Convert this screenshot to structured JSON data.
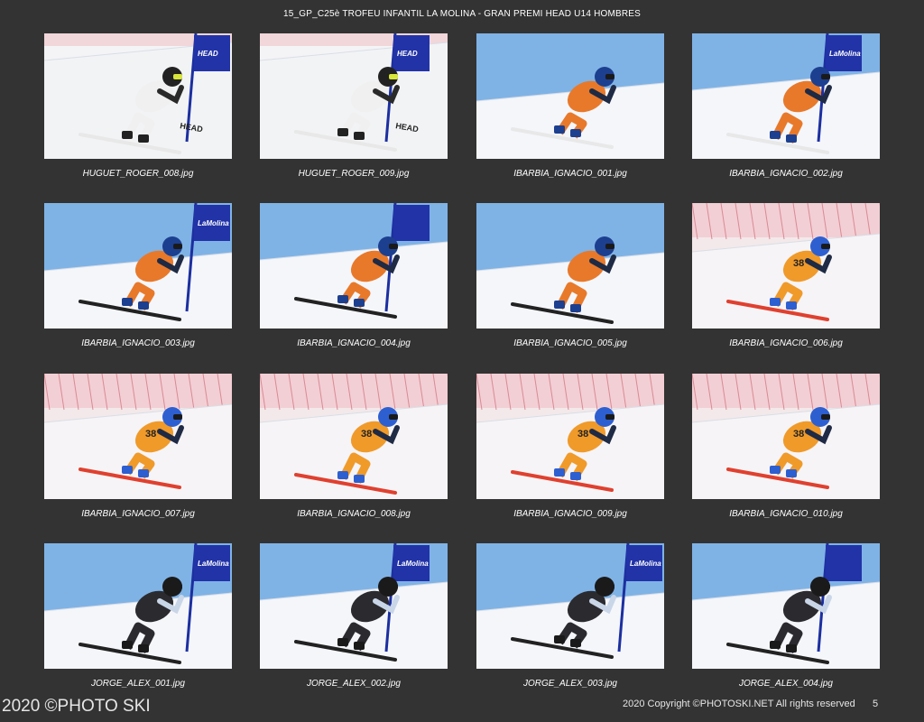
{
  "page": {
    "title": "15_GP_C25è TROFEU INFANTIL LA MOLINA - GRAN PREMI HEAD U14 HOMBRES",
    "footer_left": "2020 ©PHOTO SKI",
    "footer_right": "2020 Copyright ©PHOTOSKI.NET All rights reserved",
    "page_number": "5"
  },
  "photos": [
    {
      "filename": "HUGUET_ROGER_008.jpg",
      "scene": "white-bib-skier",
      "bib": "",
      "banner_text": "HEAD",
      "colors": {
        "sky": "#f4f4f6",
        "snow": "#f2f3f5",
        "suit": "#f0f0f0",
        "accent": "#2a2a2a",
        "helmet": "#222222",
        "visor": "#d8e63a",
        "skis": "#e8e8e8"
      }
    },
    {
      "filename": "HUGUET_ROGER_009.jpg",
      "scene": "white-bib-skier",
      "bib": "",
      "banner_text": "HEAD",
      "colors": {
        "sky": "#f4f4f6",
        "snow": "#f2f3f5",
        "suit": "#f0f0f0",
        "accent": "#2a2a2a",
        "helmet": "#222222",
        "visor": "#d8e63a",
        "skis": "#e8e8e8"
      }
    },
    {
      "filename": "IBARBIA_IGNACIO_001.jpg",
      "scene": "orange-skier-sky",
      "bib": "",
      "banner_text": "",
      "colors": {
        "sky": "#7fb3e6",
        "snow": "#f4f6fa",
        "suit": "#e8792a",
        "accent": "#1f2a44",
        "helmet": "#1d3f8f",
        "visor": "#1a1a1a",
        "skis": "#e8e8e8"
      }
    },
    {
      "filename": "IBARBIA_IGNACIO_002.jpg",
      "scene": "orange-skier-sky",
      "bib": "",
      "banner_text": "LaMolina",
      "colors": {
        "sky": "#7fb3e6",
        "snow": "#f4f6fa",
        "suit": "#e8792a",
        "accent": "#1f2a44",
        "helmet": "#1d3f8f",
        "visor": "#1a1a1a",
        "skis": "#e8e8e8"
      }
    },
    {
      "filename": "IBARBIA_IGNACIO_003.jpg",
      "scene": "orange-skier-gate",
      "bib": "",
      "banner_text": "LaMolina",
      "colors": {
        "sky": "#7fb3e6",
        "snow": "#f4f6fa",
        "suit": "#e8792a",
        "accent": "#1f2a44",
        "helmet": "#1d3f8f",
        "visor": "#1a1a1a",
        "skis": "#222222"
      }
    },
    {
      "filename": "IBARBIA_IGNACIO_004.jpg",
      "scene": "orange-skier-gate",
      "bib": "",
      "banner_text": "",
      "colors": {
        "sky": "#7fb3e6",
        "snow": "#f4f6fa",
        "suit": "#e8792a",
        "accent": "#1f2a44",
        "helmet": "#1d3f8f",
        "visor": "#1a1a1a",
        "skis": "#222222"
      }
    },
    {
      "filename": "IBARBIA_IGNACIO_005.jpg",
      "scene": "orange-skier-sky",
      "bib": "",
      "banner_text": "",
      "colors": {
        "sky": "#7fb3e6",
        "snow": "#f4f6fa",
        "suit": "#e8792a",
        "accent": "#1f2a44",
        "helmet": "#1d3f8f",
        "visor": "#1a1a1a",
        "skis": "#222222"
      }
    },
    {
      "filename": "IBARBIA_IGNACIO_006.jpg",
      "scene": "orange-skier-fence",
      "bib": "38",
      "banner_text": "",
      "colors": {
        "sky": "#f3e9ea",
        "snow": "#f6f4f6",
        "suit": "#f09a2a",
        "accent": "#1f2a44",
        "helmet": "#2e5fd1",
        "visor": "#1a1a1a",
        "skis": "#e0402f"
      }
    },
    {
      "filename": "IBARBIA_IGNACIO_007.jpg",
      "scene": "orange-skier-fence",
      "bib": "38",
      "banner_text": "",
      "colors": {
        "sky": "#f3e9ea",
        "snow": "#f6f4f6",
        "suit": "#f09a2a",
        "accent": "#1f2a44",
        "helmet": "#2e5fd1",
        "visor": "#1a1a1a",
        "skis": "#e0402f"
      }
    },
    {
      "filename": "IBARBIA_IGNACIO_008.jpg",
      "scene": "orange-skier-fence",
      "bib": "38",
      "banner_text": "",
      "colors": {
        "sky": "#f3e9ea",
        "snow": "#f6f4f6",
        "suit": "#f09a2a",
        "accent": "#1f2a44",
        "helmet": "#2e5fd1",
        "visor": "#1a1a1a",
        "skis": "#e0402f"
      }
    },
    {
      "filename": "IBARBIA_IGNACIO_009.jpg",
      "scene": "orange-skier-fence",
      "bib": "38",
      "banner_text": "",
      "colors": {
        "sky": "#f3e9ea",
        "snow": "#f6f4f6",
        "suit": "#f09a2a",
        "accent": "#1f2a44",
        "helmet": "#2e5fd1",
        "visor": "#1a1a1a",
        "skis": "#e0402f"
      }
    },
    {
      "filename": "IBARBIA_IGNACIO_010.jpg",
      "scene": "orange-skier-fence",
      "bib": "38",
      "banner_text": "",
      "colors": {
        "sky": "#f3e9ea",
        "snow": "#f6f4f6",
        "suit": "#f09a2a",
        "accent": "#1f2a44",
        "helmet": "#2e5fd1",
        "visor": "#1a1a1a",
        "skis": "#e0402f"
      }
    },
    {
      "filename": "JORGE_ALEX_001.jpg",
      "scene": "dark-skier-gate",
      "bib": "",
      "banner_text": "LaMolina",
      "colors": {
        "sky": "#7fb3e6",
        "snow": "#f4f6fa",
        "suit": "#2b2b2f",
        "accent": "#c8d6e8",
        "helmet": "#1a1a1a",
        "visor": "#1a1a1a",
        "skis": "#222222"
      }
    },
    {
      "filename": "JORGE_ALEX_002.jpg",
      "scene": "dark-skier-gate",
      "bib": "",
      "banner_text": "LaMolina",
      "colors": {
        "sky": "#7fb3e6",
        "snow": "#f4f6fa",
        "suit": "#2b2b2f",
        "accent": "#c8d6e8",
        "helmet": "#1a1a1a",
        "visor": "#1a1a1a",
        "skis": "#222222"
      }
    },
    {
      "filename": "JORGE_ALEX_003.jpg",
      "scene": "dark-skier-gate",
      "bib": "",
      "banner_text": "LaMolina",
      "colors": {
        "sky": "#7fb3e6",
        "snow": "#f4f6fa",
        "suit": "#2b2b2f",
        "accent": "#c8d6e8",
        "helmet": "#1a1a1a",
        "visor": "#1a1a1a",
        "skis": "#222222"
      }
    },
    {
      "filename": "JORGE_ALEX_004.jpg",
      "scene": "dark-skier-gate",
      "bib": "",
      "banner_text": "",
      "colors": {
        "sky": "#7fb3e6",
        "snow": "#f4f6fa",
        "suit": "#2b2b2f",
        "accent": "#c8d6e8",
        "helmet": "#1a1a1a",
        "visor": "#1a1a1a",
        "skis": "#222222"
      }
    }
  ]
}
